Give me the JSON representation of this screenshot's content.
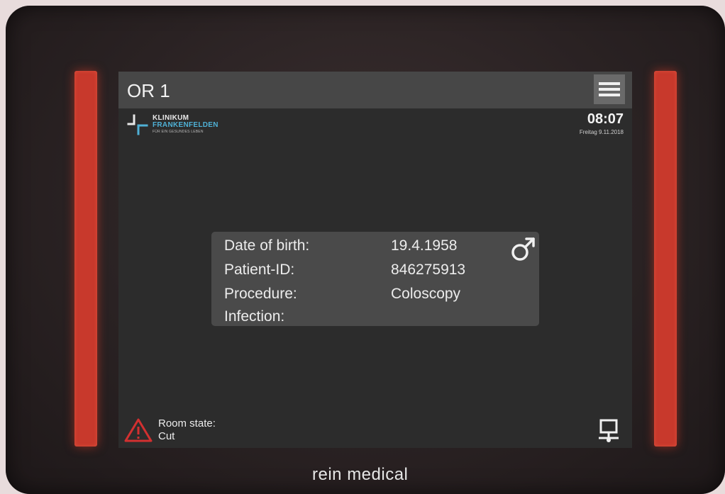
{
  "header": {
    "room": "OR 1"
  },
  "logo": {
    "line1": "KLINIKUM",
    "line2": "FRANKENFELDEN",
    "tagline": "FÜR EIN GESUNDES LEBEN"
  },
  "clock": {
    "time": "08:07",
    "date": "Freitag 9.11.2018"
  },
  "patient": {
    "rows": [
      {
        "label": "Date of birth:",
        "value": "19.4.1958"
      },
      {
        "label": "Patient-ID:",
        "value": "846275913"
      },
      {
        "label": "Procedure:",
        "value": "Coloscopy"
      },
      {
        "label": "Infection:",
        "value": ""
      }
    ],
    "gender_icon": "male-symbol-icon"
  },
  "room_state": {
    "label": "Room state:",
    "value": "Cut",
    "icon": "warning-icon"
  },
  "network_icon": "network-icon",
  "menu_icon": "hamburger-menu-icon",
  "bezel_brand": "rein medical",
  "colors": {
    "led_red": "#c8392c",
    "accent_blue": "#4fb1d6",
    "warning_red": "#d23030",
    "screen_bg": "#2c2c2c",
    "topbar_bg": "#474747"
  }
}
